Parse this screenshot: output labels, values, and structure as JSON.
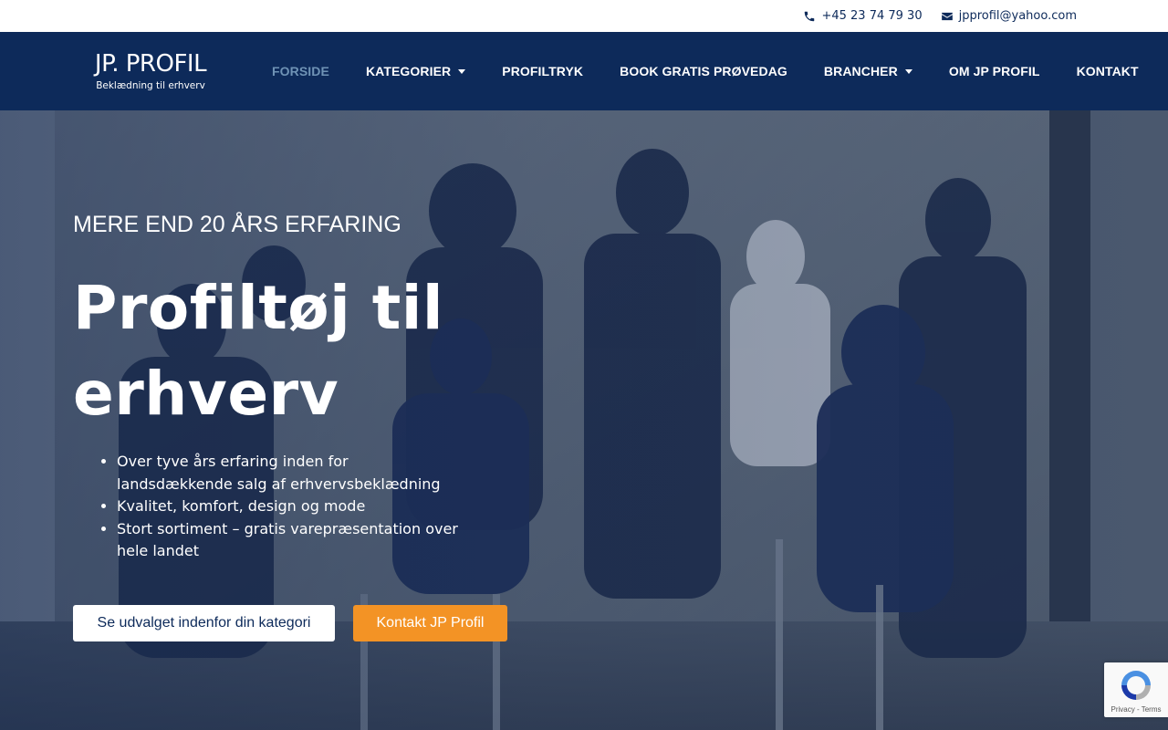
{
  "topbar": {
    "phone": "+45 23 74 79 30",
    "email": "jpprofil@yahoo.com",
    "icons": {
      "phone": "phone-icon",
      "email": "envelope-icon"
    }
  },
  "nav": {
    "logo_main": "JP. PROFIL",
    "logo_sub": "Beklædning til erhverv",
    "items": [
      {
        "label": "FORSIDE",
        "active": true,
        "has_dropdown": false
      },
      {
        "label": "KATEGORIER",
        "active": false,
        "has_dropdown": true
      },
      {
        "label": "PROFILTRYK",
        "active": false,
        "has_dropdown": false
      },
      {
        "label": "BOOK GRATIS PRØVEDAG",
        "active": false,
        "has_dropdown": false
      },
      {
        "label": "BRANCHER",
        "active": false,
        "has_dropdown": true
      },
      {
        "label": "OM JP PROFIL",
        "active": false,
        "has_dropdown": false
      },
      {
        "label": "KONTAKT",
        "active": false,
        "has_dropdown": false
      }
    ]
  },
  "hero": {
    "eyebrow": "MERE END 20 ÅRS ERFARING",
    "headline": "Profiltøj til erhverv",
    "bullets": [
      "Over tyve års erfaring inden for landsdækkende salg af erhvervsbeklædning",
      "Kvalitet, komfort, design og mode",
      "Stort sortiment – gratis varepræsentation over hele landet"
    ],
    "cta_primary": "Se udvalget indenfor din kategori",
    "cta_secondary": "Kontakt JP Profil"
  },
  "recaptcha": {
    "links": "Privacy - Terms"
  },
  "colors": {
    "navy": "#0d2a5a",
    "active_nav": "#6f93b5",
    "orange": "#f39325"
  }
}
